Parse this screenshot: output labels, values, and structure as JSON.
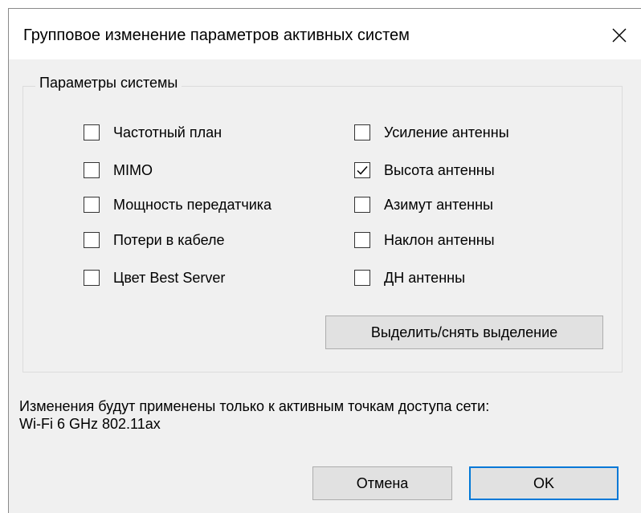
{
  "dialog": {
    "title": "Групповое изменение параметров активных систем",
    "close_icon": "close-icon"
  },
  "group": {
    "legend": "Параметры системы",
    "left_column": [
      {
        "label": "Частотный план",
        "checked": false
      },
      {
        "label": "MIMO",
        "checked": false
      },
      {
        "label": "Мощность передатчика",
        "checked": false
      },
      {
        "label": "Потери в кабеле",
        "checked": false
      },
      {
        "label": "Цвет Best Server",
        "checked": false
      }
    ],
    "right_column": [
      {
        "label": "Усиление антенны",
        "checked": false
      },
      {
        "label": "Высота антенны",
        "checked": true
      },
      {
        "label": "Азимут антенны",
        "checked": false
      },
      {
        "label": "Наклон антенны",
        "checked": false
      },
      {
        "label": "ДН антенны",
        "checked": false
      }
    ],
    "select_toggle_label": "Выделить/снять выделение"
  },
  "info": {
    "line1": "Изменения будут применены только к активным точкам доступа сети:",
    "line2": "Wi-Fi 6 GHz 802.11ax"
  },
  "buttons": {
    "cancel_label": "Отмена",
    "ok_label": "OK"
  },
  "colors": {
    "dialog_bg": "#f0f0f0",
    "titlebar_bg": "#ffffff",
    "button_bg": "#e1e1e1",
    "default_button_border": "#0078d7"
  }
}
